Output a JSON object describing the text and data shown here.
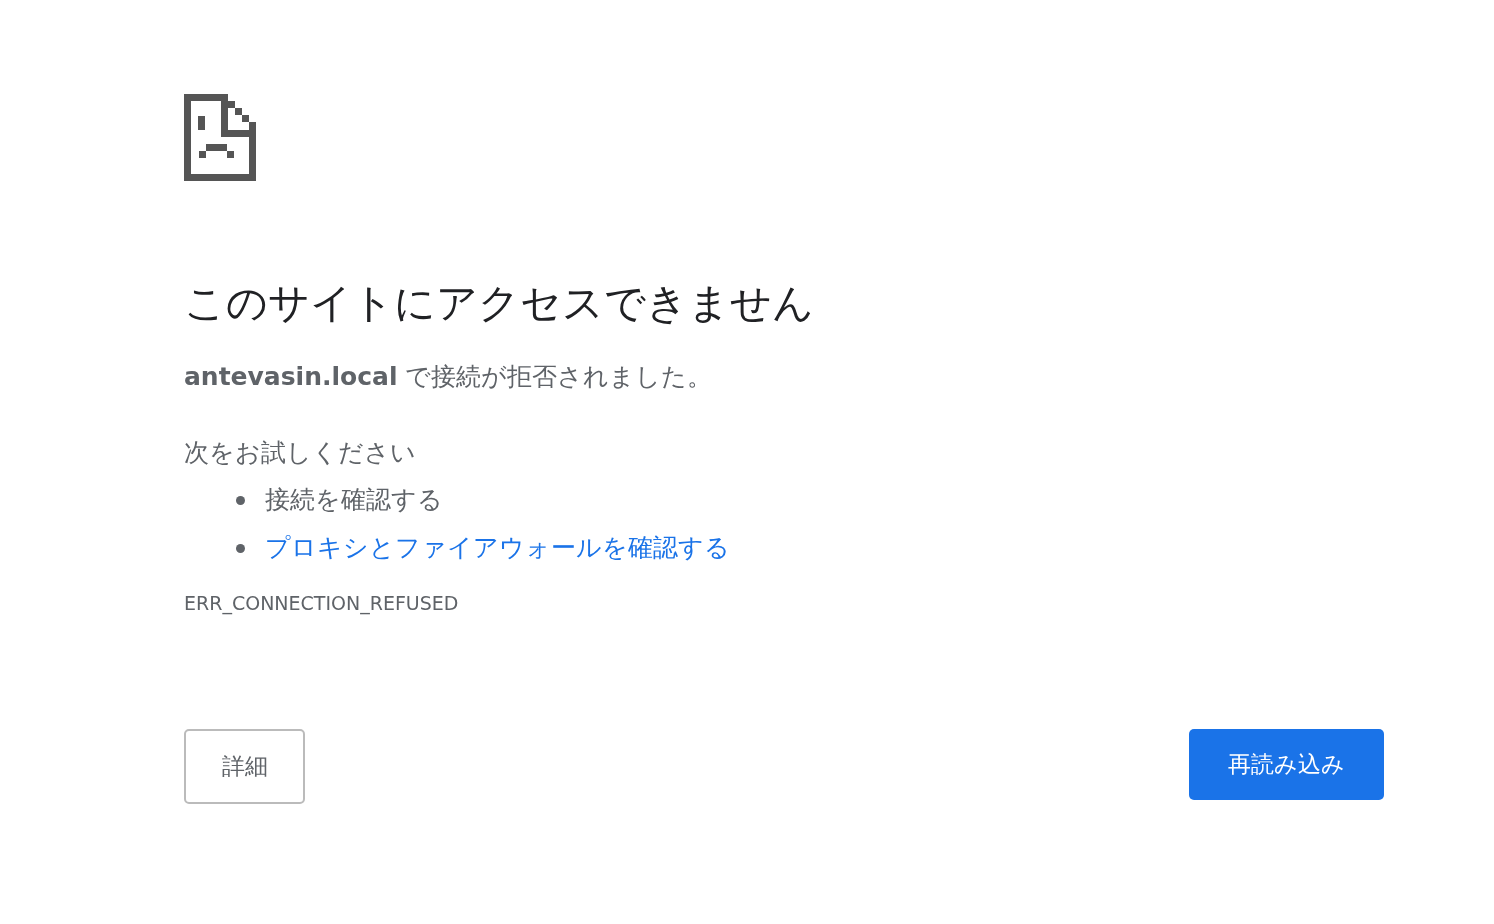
{
  "heading": "このサイトにアクセスできません",
  "message": "**antevasin.local** で接続が拒否されました。",
  "suggestions_title": "次をお試しください",
  "suggestions": [
    {
      "text": "接続を確認する",
      "kind": "text"
    },
    {
      "text": "プロキシとファイアウォールを確認する",
      "kind": "link"
    }
  ],
  "error_code": "ERR_CONNECTION_REFUSED",
  "buttons": [
    {
      "label": "詳細",
      "kind": "secondary"
    },
    {
      "label": "再読み込み",
      "kind": "primary"
    }
  ]
}
